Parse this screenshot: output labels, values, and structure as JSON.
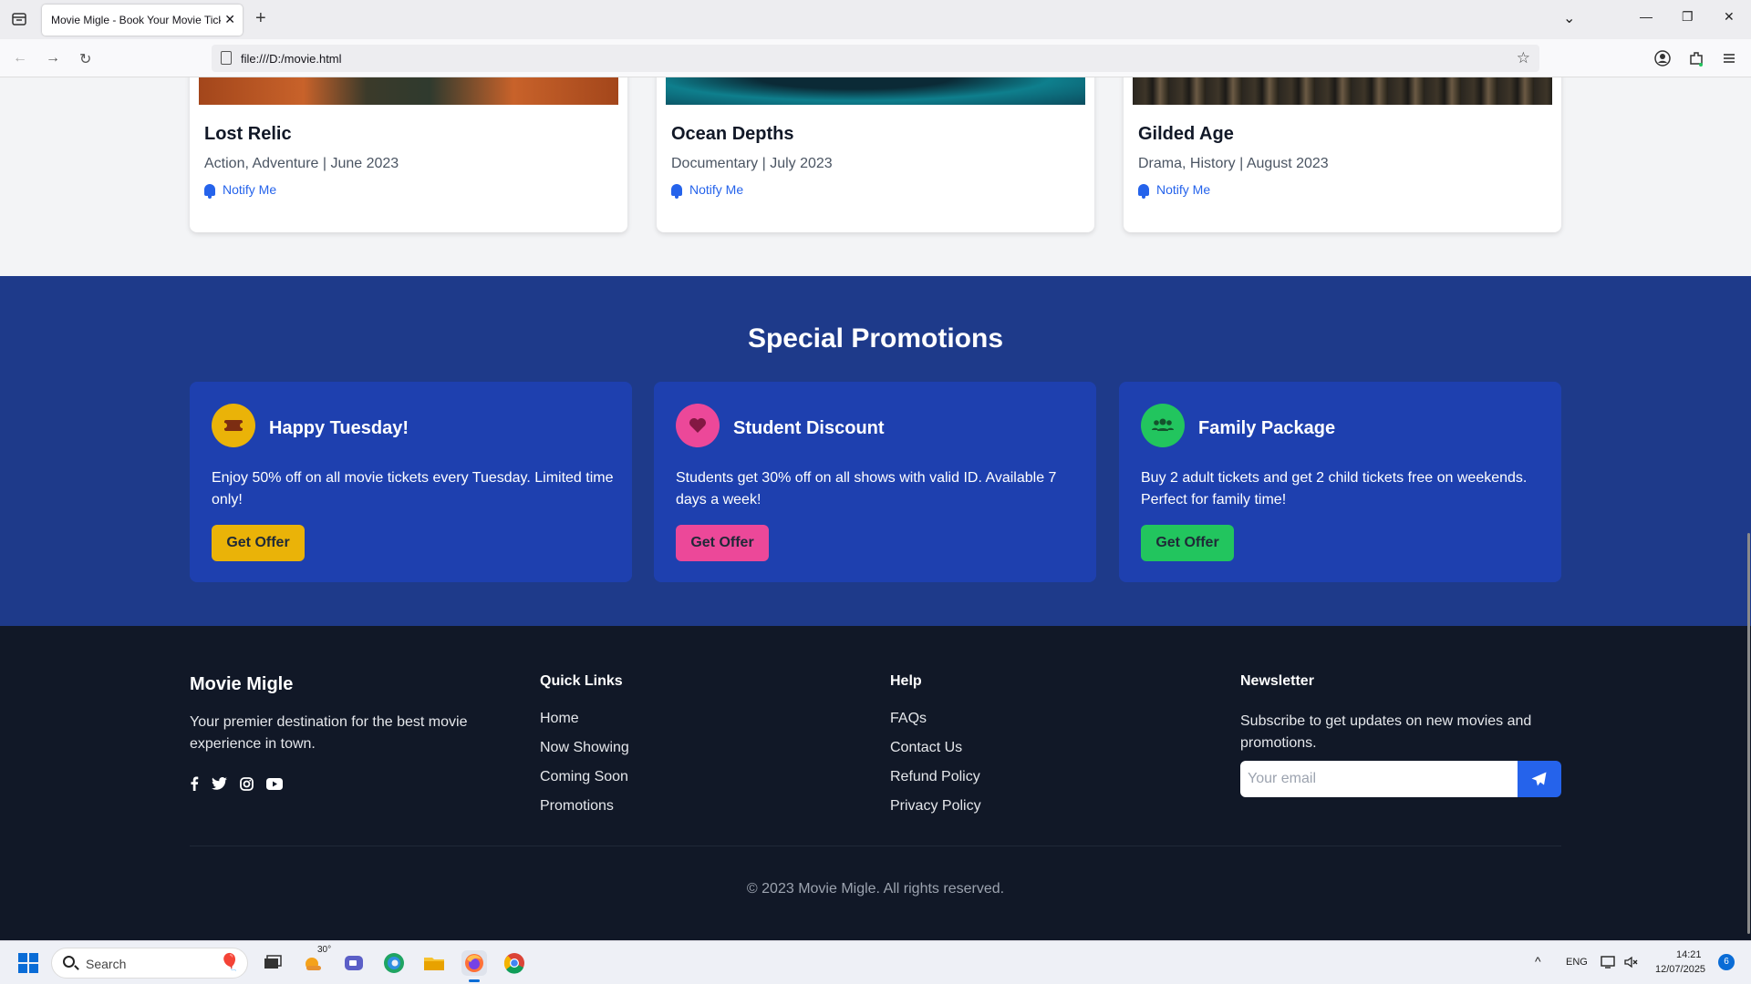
{
  "browser": {
    "tab_title": "Movie Migle - Book Your Movie Tickets",
    "tab_close": "✕",
    "new_tab": "+",
    "url": "file:///D:/movie.html",
    "win_controls": {
      "minimize": "—",
      "restore": "❐",
      "close": "✕",
      "list": "⌄"
    }
  },
  "coming_soon": [
    {
      "title": "Lost Relic",
      "meta": "Action, Adventure | June 2023",
      "notify": "Notify Me"
    },
    {
      "title": "Ocean Depths",
      "meta": "Documentary | July 2023",
      "notify": "Notify Me"
    },
    {
      "title": "Gilded Age",
      "meta": "Drama, History | August 2023",
      "notify": "Notify Me"
    }
  ],
  "promotions": {
    "heading": "Special Promotions",
    "cards": [
      {
        "title": "Happy Tuesday!",
        "desc": "Enjoy 50% off on all movie tickets every Tuesday. Limited time only!",
        "button": "Get Offer",
        "accent": "#eab308",
        "icon": "ticket-icon"
      },
      {
        "title": "Student Discount",
        "desc": "Students get 30% off on all shows with valid ID. Available 7 days a week!",
        "button": "Get Offer",
        "accent": "#ec4899",
        "icon": "heart-icon"
      },
      {
        "title": "Family Package",
        "desc": "Buy 2 adult tickets and get 2 child tickets free on weekends. Perfect for family time!",
        "button": "Get Offer",
        "accent": "#22c55e",
        "icon": "users-icon"
      }
    ]
  },
  "footer": {
    "brand": "Movie Migle",
    "tagline": "Your premier destination for the best movie experience in town.",
    "social": [
      "facebook-icon",
      "twitter-icon",
      "instagram-icon",
      "youtube-icon"
    ],
    "quick_links": {
      "heading": "Quick Links",
      "items": [
        "Home",
        "Now Showing",
        "Coming Soon",
        "Promotions"
      ]
    },
    "help": {
      "heading": "Help",
      "items": [
        "FAQs",
        "Contact Us",
        "Refund Policy",
        "Privacy Policy"
      ]
    },
    "newsletter": {
      "heading": "Newsletter",
      "text": "Subscribe to get updates on new movies and promotions.",
      "placeholder": "Your email"
    },
    "copyright": "© 2023 Movie Migle. All rights reserved."
  },
  "taskbar": {
    "search": "Search",
    "weather": "30°",
    "lang": "ENG",
    "time": "14:21",
    "date": "12/07/2025",
    "badge": "6"
  },
  "colors": {
    "promo_bg": "#1e3a8a",
    "promo_card": "#1e40af",
    "footer_bg": "#111827",
    "link_blue": "#2563eb"
  }
}
